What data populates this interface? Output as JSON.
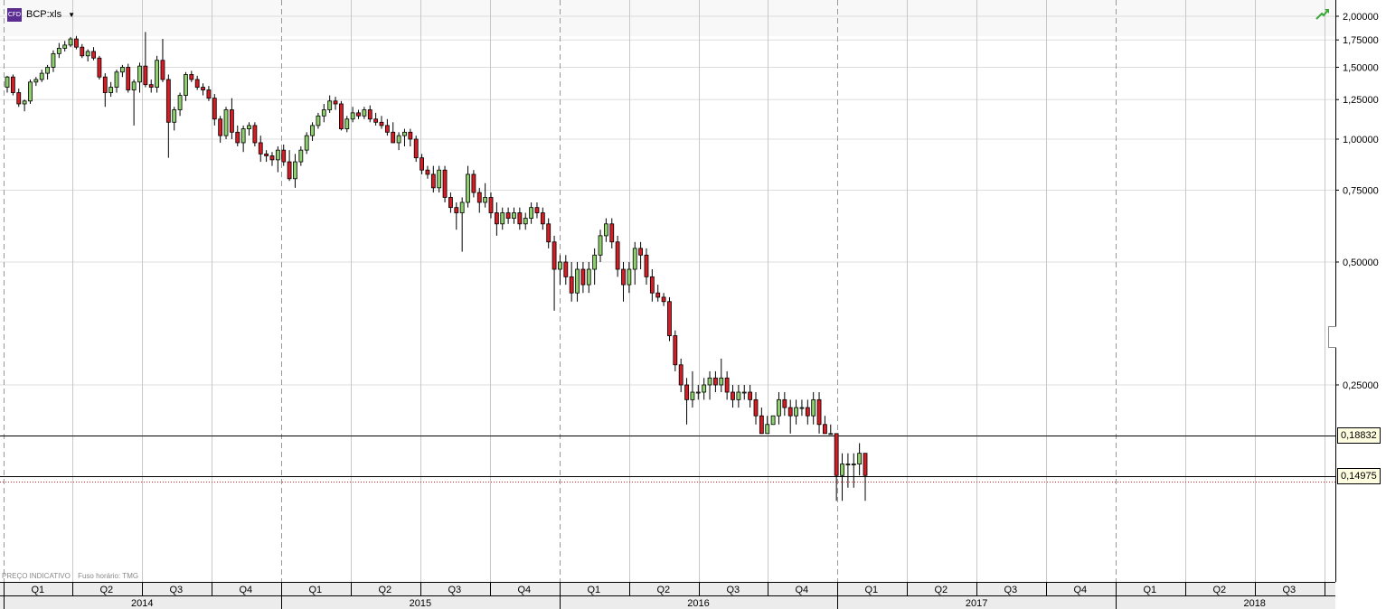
{
  "header": {
    "icon_label": "CFD",
    "symbol": "BCP:xls",
    "dropdown_icon": "caret-down"
  },
  "status_icon": "trend-up-arrow-icon",
  "footnote": {
    "indicative": "PREÇO INDICATIVO",
    "timezone": "Fuso horário: TMG"
  },
  "price_tags": {
    "upper": "0,18832",
    "lower": "0,14975"
  },
  "colors": {
    "up": "#8fcf6e",
    "down": "#d41d24",
    "grid": "#dddddd",
    "quarter_sep": "#c8c8c8",
    "year_sep": "#999999"
  },
  "chart_data": {
    "type": "candlestick",
    "y_scale": "log",
    "ylim": [
      0.09,
      2.05
    ],
    "y_ticks": [
      {
        "value": 2.0,
        "label": "2,00000"
      },
      {
        "value": 1.75,
        "label": "1,75000"
      },
      {
        "value": 1.5,
        "label": "1,50000"
      },
      {
        "value": 1.25,
        "label": "1,25000"
      },
      {
        "value": 1.0,
        "label": "1,00000"
      },
      {
        "value": 0.75,
        "label": "0,75000"
      },
      {
        "value": 0.5,
        "label": "0,50000"
      },
      {
        "value": 0.25,
        "label": "0,25000"
      }
    ],
    "horizontal_lines": [
      {
        "value": 0.18832,
        "style": "solid",
        "color": "#000000"
      },
      {
        "value": 0.14975,
        "style": "solid",
        "color": "#000000"
      },
      {
        "value": 0.1448,
        "style": "dotted",
        "color": "#d41d24"
      }
    ],
    "x_quarters": [
      "Q1",
      "Q2",
      "Q3",
      "Q4",
      "Q1",
      "Q2",
      "Q3",
      "Q4",
      "Q1",
      "Q2",
      "Q3",
      "Q4",
      "Q1",
      "Q2",
      "Q3",
      "Q4",
      "Q1",
      "Q2",
      "Q3",
      ""
    ],
    "x_years": [
      "2014",
      "2015",
      "2016",
      "2017",
      "2018"
    ],
    "candles": [
      [
        1.34,
        1.43,
        1.3,
        1.42
      ],
      [
        1.42,
        1.44,
        1.28,
        1.3
      ],
      [
        1.3,
        1.33,
        1.2,
        1.22
      ],
      [
        1.22,
        1.25,
        1.17,
        1.24
      ],
      [
        1.24,
        1.4,
        1.22,
        1.38
      ],
      [
        1.38,
        1.42,
        1.35,
        1.4
      ],
      [
        1.4,
        1.48,
        1.38,
        1.45
      ],
      [
        1.45,
        1.52,
        1.4,
        1.5
      ],
      [
        1.5,
        1.65,
        1.46,
        1.62
      ],
      [
        1.62,
        1.72,
        1.58,
        1.67
      ],
      [
        1.67,
        1.74,
        1.64,
        1.7
      ],
      [
        1.7,
        1.78,
        1.68,
        1.76
      ],
      [
        1.76,
        1.79,
        1.66,
        1.68
      ],
      [
        1.68,
        1.71,
        1.58,
        1.6
      ],
      [
        1.6,
        1.66,
        1.55,
        1.64
      ],
      [
        1.64,
        1.68,
        1.56,
        1.58
      ],
      [
        1.58,
        1.6,
        1.4,
        1.42
      ],
      [
        1.42,
        1.45,
        1.2,
        1.3
      ],
      [
        1.3,
        1.38,
        1.27,
        1.34
      ],
      [
        1.34,
        1.48,
        1.3,
        1.46
      ],
      [
        1.46,
        1.52,
        1.42,
        1.5
      ],
      [
        1.5,
        1.53,
        1.3,
        1.32
      ],
      [
        1.32,
        1.4,
        1.08,
        1.38
      ],
      [
        1.38,
        1.54,
        1.3,
        1.51
      ],
      [
        1.51,
        1.83,
        1.34,
        1.36
      ],
      [
        1.36,
        1.4,
        1.3,
        1.34
      ],
      [
        1.34,
        1.6,
        1.3,
        1.56
      ],
      [
        1.56,
        1.76,
        1.38,
        1.4
      ],
      [
        1.4,
        1.44,
        0.9,
        1.1
      ],
      [
        1.1,
        1.2,
        1.05,
        1.18
      ],
      [
        1.18,
        1.3,
        1.14,
        1.28
      ],
      [
        1.28,
        1.46,
        1.24,
        1.44
      ],
      [
        1.44,
        1.47,
        1.38,
        1.4
      ],
      [
        1.4,
        1.43,
        1.32,
        1.34
      ],
      [
        1.34,
        1.37,
        1.28,
        1.32
      ],
      [
        1.32,
        1.35,
        1.24,
        1.26
      ],
      [
        1.26,
        1.29,
        1.08,
        1.12
      ],
      [
        1.12,
        1.14,
        0.98,
        1.02
      ],
      [
        1.02,
        1.2,
        1.0,
        1.18
      ],
      [
        1.18,
        1.26,
        1.0,
        1.04
      ],
      [
        1.04,
        1.08,
        0.96,
        0.98
      ],
      [
        0.98,
        1.08,
        0.93,
        1.06
      ],
      [
        1.06,
        1.1,
        1.02,
        1.08
      ],
      [
        1.08,
        1.1,
        0.96,
        0.98
      ],
      [
        0.98,
        1.02,
        0.88,
        0.92
      ],
      [
        0.92,
        0.94,
        0.88,
        0.91
      ],
      [
        0.91,
        0.93,
        0.86,
        0.89
      ],
      [
        0.89,
        0.96,
        0.83,
        0.94
      ],
      [
        0.94,
        0.97,
        0.86,
        0.88
      ],
      [
        0.88,
        0.94,
        0.79,
        0.8
      ],
      [
        0.8,
        0.92,
        0.76,
        0.88
      ],
      [
        0.88,
        0.96,
        0.86,
        0.94
      ],
      [
        0.94,
        1.04,
        0.92,
        1.02
      ],
      [
        1.02,
        1.1,
        0.99,
        1.08
      ],
      [
        1.08,
        1.16,
        1.06,
        1.14
      ],
      [
        1.14,
        1.22,
        1.1,
        1.18
      ],
      [
        1.18,
        1.28,
        1.16,
        1.24
      ],
      [
        1.24,
        1.27,
        1.18,
        1.22
      ],
      [
        1.22,
        1.24,
        1.05,
        1.06
      ],
      [
        1.06,
        1.14,
        1.04,
        1.12
      ],
      [
        1.12,
        1.2,
        1.1,
        1.16
      ],
      [
        1.16,
        1.18,
        1.12,
        1.14
      ],
      [
        1.14,
        1.2,
        1.12,
        1.18
      ],
      [
        1.18,
        1.21,
        1.1,
        1.12
      ],
      [
        1.12,
        1.16,
        1.08,
        1.1
      ],
      [
        1.1,
        1.14,
        1.06,
        1.08
      ],
      [
        1.08,
        1.12,
        1.02,
        1.04
      ],
      [
        1.04,
        1.1,
        0.98,
        0.98
      ],
      [
        0.98,
        1.04,
        0.94,
        1.02
      ],
      [
        1.02,
        1.06,
        0.96,
        1.04
      ],
      [
        1.04,
        1.06,
        0.96,
        1.0
      ],
      [
        1.0,
        1.02,
        0.88,
        0.9
      ],
      [
        0.9,
        0.92,
        0.82,
        0.84
      ],
      [
        0.84,
        0.86,
        0.8,
        0.82
      ],
      [
        0.82,
        0.86,
        0.74,
        0.76
      ],
      [
        0.76,
        0.86,
        0.74,
        0.84
      ],
      [
        0.84,
        0.86,
        0.7,
        0.72
      ],
      [
        0.72,
        0.74,
        0.66,
        0.68
      ],
      [
        0.68,
        0.7,
        0.6,
        0.66
      ],
      [
        0.66,
        0.72,
        0.53,
        0.7
      ],
      [
        0.7,
        0.86,
        0.68,
        0.82
      ],
      [
        0.82,
        0.84,
        0.72,
        0.74
      ],
      [
        0.74,
        0.76,
        0.66,
        0.7
      ],
      [
        0.7,
        0.78,
        0.68,
        0.72
      ],
      [
        0.72,
        0.74,
        0.64,
        0.66
      ],
      [
        0.66,
        0.7,
        0.58,
        0.62
      ],
      [
        0.62,
        0.68,
        0.6,
        0.66
      ],
      [
        0.66,
        0.68,
        0.62,
        0.64
      ],
      [
        0.64,
        0.68,
        0.62,
        0.66
      ],
      [
        0.66,
        0.68,
        0.6,
        0.62
      ],
      [
        0.62,
        0.66,
        0.6,
        0.64
      ],
      [
        0.64,
        0.7,
        0.62,
        0.68
      ],
      [
        0.68,
        0.7,
        0.64,
        0.66
      ],
      [
        0.66,
        0.68,
        0.6,
        0.62
      ],
      [
        0.62,
        0.64,
        0.54,
        0.56
      ],
      [
        0.56,
        0.58,
        0.38,
        0.48
      ],
      [
        0.48,
        0.52,
        0.44,
        0.5
      ],
      [
        0.5,
        0.52,
        0.44,
        0.46
      ],
      [
        0.46,
        0.5,
        0.4,
        0.42
      ],
      [
        0.42,
        0.5,
        0.4,
        0.48
      ],
      [
        0.48,
        0.5,
        0.42,
        0.44
      ],
      [
        0.44,
        0.5,
        0.42,
        0.48
      ],
      [
        0.48,
        0.54,
        0.44,
        0.52
      ],
      [
        0.52,
        0.6,
        0.5,
        0.58
      ],
      [
        0.58,
        0.64,
        0.56,
        0.62
      ],
      [
        0.62,
        0.64,
        0.54,
        0.56
      ],
      [
        0.56,
        0.58,
        0.46,
        0.48
      ],
      [
        0.48,
        0.5,
        0.4,
        0.44
      ],
      [
        0.44,
        0.5,
        0.42,
        0.48
      ],
      [
        0.48,
        0.56,
        0.44,
        0.54
      ],
      [
        0.54,
        0.56,
        0.48,
        0.52
      ],
      [
        0.52,
        0.54,
        0.44,
        0.46
      ],
      [
        0.46,
        0.48,
        0.4,
        0.42
      ],
      [
        0.42,
        0.44,
        0.4,
        0.41
      ],
      [
        0.41,
        0.42,
        0.39,
        0.4
      ],
      [
        0.4,
        0.41,
        0.32,
        0.33
      ],
      [
        0.33,
        0.34,
        0.27,
        0.28
      ],
      [
        0.28,
        0.29,
        0.24,
        0.25
      ],
      [
        0.25,
        0.26,
        0.2,
        0.23
      ],
      [
        0.23,
        0.27,
        0.22,
        0.24
      ],
      [
        0.24,
        0.25,
        0.23,
        0.24
      ],
      [
        0.24,
        0.26,
        0.23,
        0.25
      ],
      [
        0.25,
        0.27,
        0.23,
        0.26
      ],
      [
        0.26,
        0.27,
        0.24,
        0.25
      ],
      [
        0.25,
        0.29,
        0.24,
        0.26
      ],
      [
        0.26,
        0.27,
        0.23,
        0.24
      ],
      [
        0.24,
        0.25,
        0.22,
        0.23
      ],
      [
        0.23,
        0.25,
        0.22,
        0.24
      ],
      [
        0.24,
        0.25,
        0.23,
        0.24
      ],
      [
        0.24,
        0.25,
        0.22,
        0.23
      ],
      [
        0.23,
        0.24,
        0.2,
        0.21
      ],
      [
        0.21,
        0.22,
        0.19,
        0.19
      ],
      [
        0.19,
        0.21,
        0.19,
        0.2
      ],
      [
        0.2,
        0.21,
        0.2,
        0.21
      ],
      [
        0.21,
        0.24,
        0.2,
        0.23
      ],
      [
        0.23,
        0.24,
        0.21,
        0.22
      ],
      [
        0.22,
        0.23,
        0.19,
        0.21
      ],
      [
        0.21,
        0.23,
        0.2,
        0.22
      ],
      [
        0.22,
        0.23,
        0.21,
        0.22
      ],
      [
        0.22,
        0.23,
        0.2,
        0.21
      ],
      [
        0.21,
        0.24,
        0.2,
        0.23
      ],
      [
        0.23,
        0.24,
        0.19,
        0.2
      ],
      [
        0.2,
        0.21,
        0.19,
        0.19
      ],
      [
        0.19,
        0.2,
        0.19,
        0.19
      ],
      [
        0.19,
        0.19,
        0.13,
        0.15
      ],
      [
        0.15,
        0.17,
        0.13,
        0.16
      ],
      [
        0.16,
        0.17,
        0.14,
        0.16
      ],
      [
        0.16,
        0.17,
        0.14,
        0.16
      ],
      [
        0.16,
        0.18,
        0.15,
        0.17
      ],
      [
        0.17,
        0.17,
        0.13,
        0.15
      ]
    ]
  }
}
